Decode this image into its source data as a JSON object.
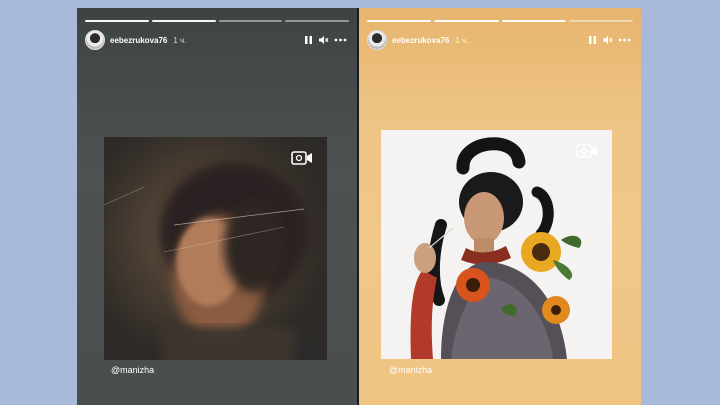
{
  "stories": [
    {
      "username": "eebezrukova76",
      "time": "1 ч.",
      "mention": "@manizha",
      "progress": [
        1,
        1,
        0,
        0
      ]
    },
    {
      "username": "eebezrukova76",
      "time": "1 ч.",
      "mention": "@manizha",
      "progress": [
        1,
        1,
        1,
        0
      ]
    }
  ],
  "icons": {
    "pause": "pause-icon",
    "volume": "volume-icon",
    "more": "more-icon",
    "video": "video-icon"
  },
  "colors": {
    "background": "#a8b9d9",
    "left_story": "#4a4e4e",
    "right_story": "#f1c88b"
  }
}
